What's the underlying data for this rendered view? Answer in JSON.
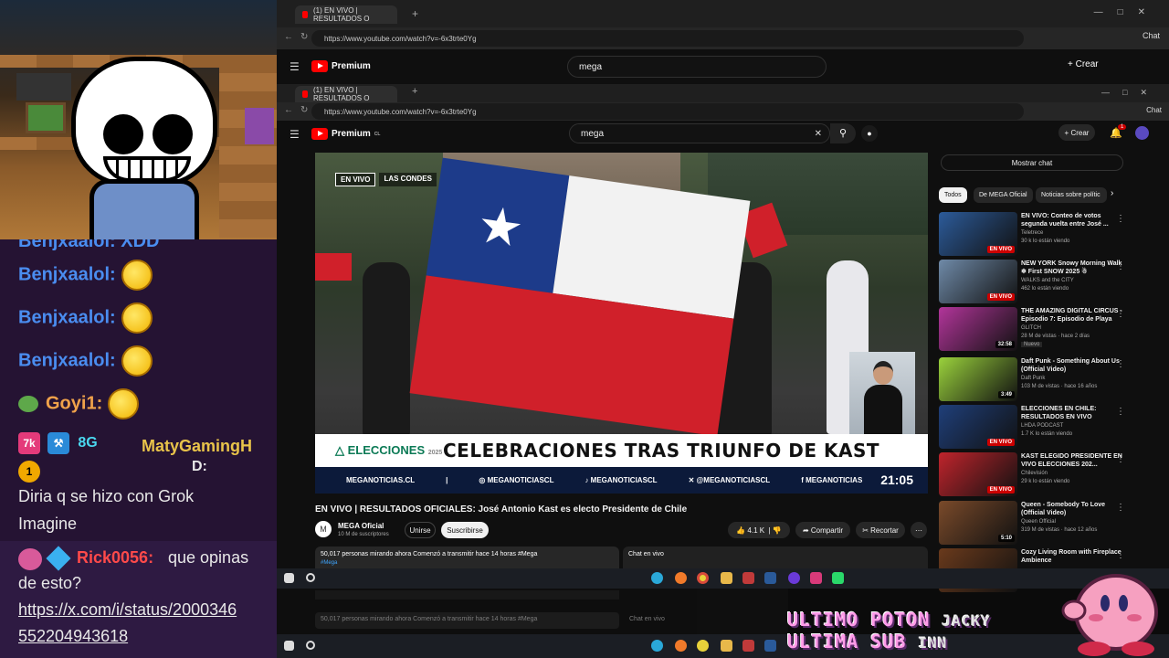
{
  "stream_overlay": {
    "chat": [
      {
        "user": "Benjxaalol:",
        "emote": "thinking-emote"
      },
      {
        "user": "Benjxaalol:",
        "emote": "thinking-emote"
      },
      {
        "user": "Benjxaalol:",
        "emote": "thinking-emote"
      },
      {
        "user": "Benjxaalol:",
        "emote": "thinking-emote"
      },
      {
        "user": "Goyi1:",
        "emote": "thinking-emote"
      }
    ],
    "cut_top_user": "Benjxaalol: XDD",
    "maty": {
      "badges": [
        "7k",
        "",
        "8G"
      ],
      "sub_badge": "1",
      "user": "MatyGamingH",
      "suffix": "D:",
      "message_line1": "Diria q se hizo con Grok",
      "message_line2": "Imagine"
    },
    "rick": {
      "user": "Rick0056:",
      "message": "que opinas",
      "message_line2": "de esto?",
      "link_line1": "https://x.com/i/status/2000346",
      "link_line2": "552204943618"
    },
    "alert_line1": "ULTIMO POTON",
    "alert_line1_name": "JACKY",
    "alert_line2": "ULTIMA SUB",
    "alert_line2_name": "INN"
  },
  "browser": {
    "tab_title": "(1) EN VIVO | RESULTADOS O",
    "new_tab": "+",
    "url": "https://www.youtube.com/watch?v=-6x3trte0Yg",
    "chat_label": "Chat"
  },
  "youtube": {
    "logo": "Premium",
    "logo_sup": "CL",
    "search_value": "mega",
    "create_label": "Crear",
    "notification_count": "1",
    "show_chat": "Mostrar chat",
    "chips": [
      "Todos",
      "De MEGA Oficial",
      "Noticias sobre polític"
    ],
    "video": {
      "tag_live": "EN VIVO",
      "tag_location": "LAS CONDES",
      "elecciones_logo": "ELECCIONES",
      "elecciones_year": "2025",
      "headline": "CELEBRACIONES TRAS TRIUNFO DE KAST",
      "ticker": [
        "MEGANOTICIAS.CL",
        "|",
        "◎ MEGANOTICIASCL",
        "♪ MEGANOTICIASCL",
        "✕ @MEGANOTICIASCL",
        "f MEGANOTICIAS"
      ],
      "clock": "21:05"
    },
    "title": "EN VIVO | RESULTADOS OFICIALES: José Antonio Kast es electo Presidente de Chile",
    "channel": "MEGA Oficial",
    "subscribers": "10 M de suscriptores",
    "join": "Unirse",
    "subscribe": "Suscribirse",
    "likes": "4.1 K",
    "share": "Compartir",
    "clip": "Recortar",
    "description_line": "50,017 personas mirando ahora  Comenzó a transmitir hace 14 horas  #Mega",
    "hashtag": "#Mega",
    "live_chat": "Chat en vivo",
    "recommendations": [
      {
        "title": "EN VIVO: Conteo de votos segunda vuelta entre José ...",
        "channel": "Teletrece",
        "meta": "30 k lo están viendo",
        "badge": "EN VIVO",
        "thumb": "#2c5b9a"
      },
      {
        "title": "NEW YORK Snowy Morning Walk ❄ First SNOW 2025 ☃",
        "channel": "WALKS and the CITY",
        "meta": "462 lo están viendo",
        "badge": "EN VIVO",
        "thumb": "#6f8aa8"
      },
      {
        "title": "THE AMAZING DIGITAL CIRCUS - Episodio 7: Episodio de Playa",
        "channel": "GLITCH",
        "meta": "28 M de vistas · hace 2 días",
        "badge": "32:58",
        "extra": "Nuevo",
        "thumb": "#b2359a"
      },
      {
        "title": "Daft Punk - Something About Us (Official Video)",
        "channel": "Daft Punk",
        "meta": "103 M de vistas · hace 16 años",
        "badge": "3:49",
        "thumb": "#9ad23c"
      },
      {
        "title": "ELECCIONES EN CHILE: RESULTADOS EN VIVO",
        "channel": "LHDA PODCAST",
        "meta": "1.7 K lo están viendo",
        "badge": "EN VIVO",
        "thumb": "#1f3f7a"
      },
      {
        "title": "KAST ELEGIDO PRESIDENTE EN VIVO ELECCIONES 202...",
        "channel": "Chilevisión",
        "meta": "29 k lo están viendo",
        "badge": "EN VIVO",
        "thumb": "#c0242c"
      },
      {
        "title": "Queen - Somebody To Love (Official Video)",
        "channel": "Queen Official",
        "meta": "319 M de vistas · hace 12 años",
        "badge": "5:10",
        "thumb": "#7a4a2a"
      },
      {
        "title": "Cozy Living Room with Fireplace Ambience",
        "channel": "",
        "meta": "",
        "badge": "",
        "thumb": "#6a3a1c"
      }
    ]
  },
  "taskbar": {
    "icons": [
      "windows-icon",
      "search-icon",
      "edge-icon",
      "firefox-icon",
      "chrome-icon",
      "folder-icon",
      "app-icon",
      "steam-icon",
      "obs-icon",
      "app2-icon",
      "app3-icon"
    ]
  }
}
